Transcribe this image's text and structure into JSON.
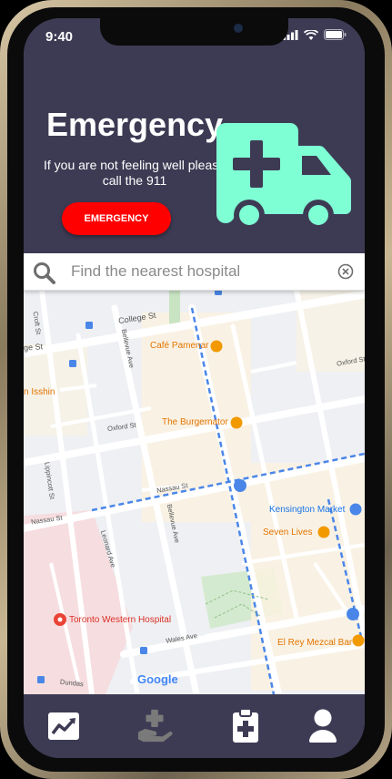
{
  "status": {
    "time": "9:40"
  },
  "header": {
    "title": "Emergency",
    "subtitle": "If you are not feeling well please call the 911",
    "button_label": "EMERGENCY"
  },
  "search": {
    "placeholder": "Find the nearest hospital"
  },
  "map": {
    "pois": {
      "cafe": "Café Pamenar",
      "burger": "The Burgernator",
      "kensington": "Kensington Market",
      "seven": "Seven Lives",
      "hospital": "Toronto Western Hospital",
      "elrey": "El Rey Mezcal Bar",
      "isshin": "n Isshin"
    },
    "streets": {
      "college": "College St",
      "oxford": "Oxford St",
      "oxford2": "Oxford St",
      "nassau": "Nassau St",
      "nassau2": "Nassau St",
      "bellevue": "Bellevue Ave",
      "bellevue2": "Bellevue Ave",
      "leonard": "Leonard Ave",
      "lippincott": "Lippincott St",
      "wales": "Wales Ave",
      "dundas": "Dundas",
      "croft": "Croft St",
      "gest": "ge St"
    },
    "attribution": "Google"
  },
  "nav": {
    "items": [
      "stats",
      "donate",
      "records",
      "profile"
    ]
  },
  "colors": {
    "header_bg": "#3d3b54",
    "accent": "#7fffd4",
    "emergency": "#ff0000"
  }
}
